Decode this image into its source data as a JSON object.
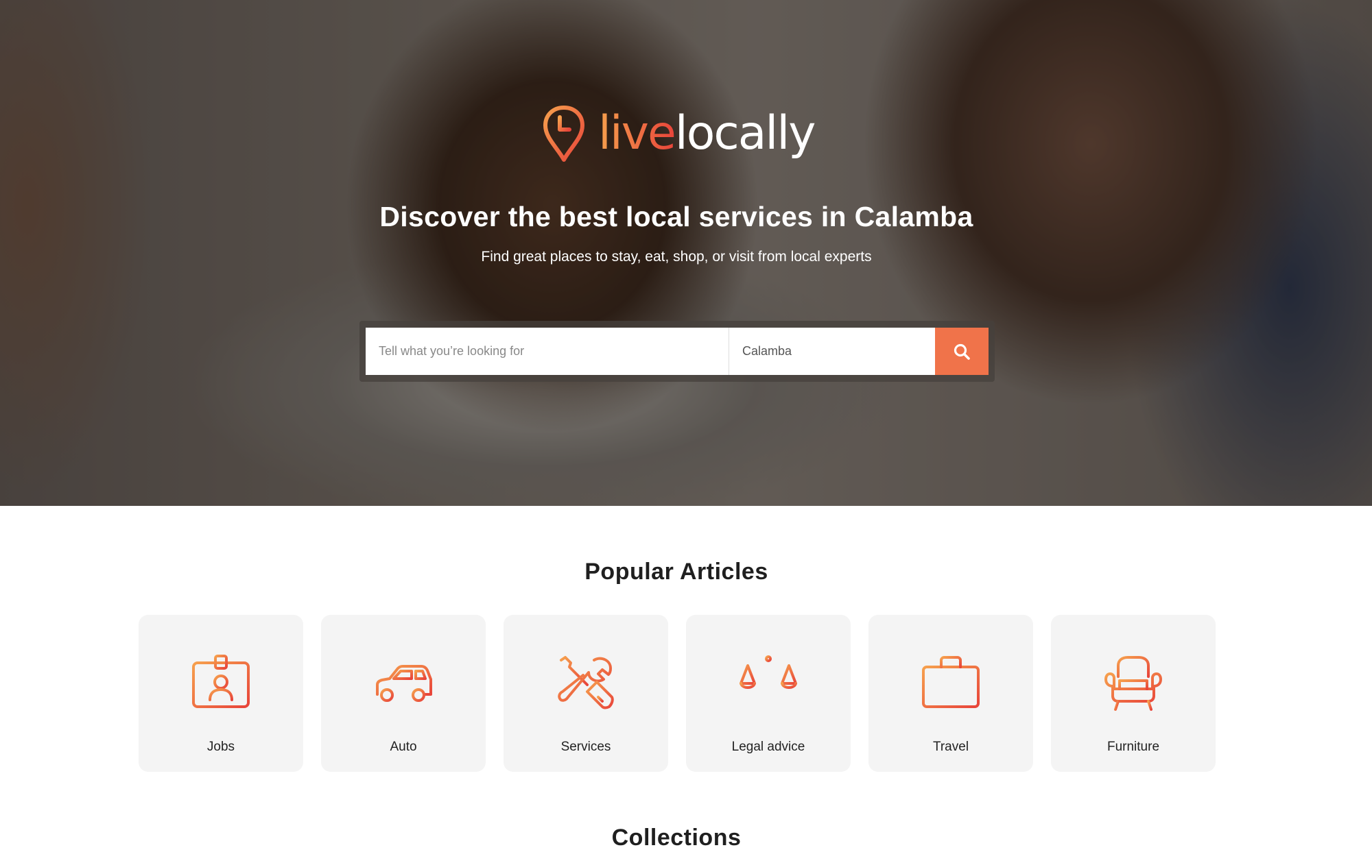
{
  "brand": {
    "name_part1": "live",
    "name_part2": "locally",
    "accent_start": "#f6a04d",
    "accent_end": "#e8443a"
  },
  "hero": {
    "title": "Discover the best local services in Calamba",
    "subtitle": "Find great places to stay, eat, shop, or visit from local experts"
  },
  "search": {
    "what_placeholder": "Tell what you’re looking for",
    "where_value": "Calamba",
    "button_icon": "search-icon",
    "button_color": "#f0734a"
  },
  "popular": {
    "title": "Popular Articles",
    "items": [
      {
        "label": "Jobs",
        "icon": "id-badge-icon"
      },
      {
        "label": "Auto",
        "icon": "car-icon"
      },
      {
        "label": "Services",
        "icon": "tools-icon"
      },
      {
        "label": "Legal advice",
        "icon": "scales-icon"
      },
      {
        "label": "Travel",
        "icon": "suitcase-icon"
      },
      {
        "label": "Furniture",
        "icon": "armchair-icon"
      }
    ]
  },
  "collections": {
    "title": "Collections"
  }
}
